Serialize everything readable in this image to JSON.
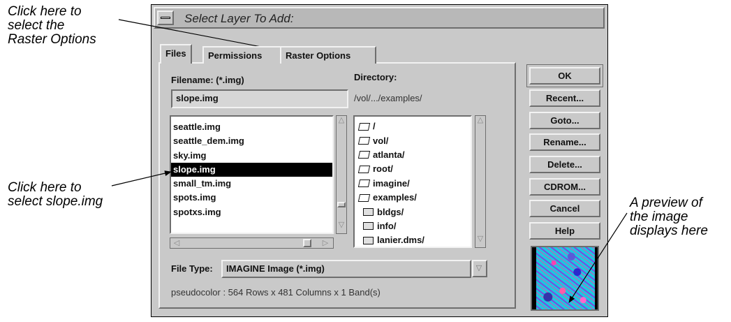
{
  "annotations": {
    "tabs_callout": [
      "Click here to",
      "select the",
      "Raster Options"
    ],
    "file_callout": [
      "Click here to",
      "select slope.img"
    ],
    "preview_callout": [
      "A preview of",
      "the image",
      "displays here"
    ]
  },
  "dialog": {
    "title": "Select Layer To Add:",
    "tabs": [
      "Files",
      "Permissions",
      "Raster Options"
    ],
    "filename_label": "Filename: (*.img)",
    "filename_value": "slope.img",
    "directory_label": "Directory:",
    "directory_value": "/vol/.../examples/",
    "files": [
      "seattle.img",
      "seattle_dem.img",
      "sky.img",
      "slope.img",
      "small_tm.img",
      "spots.img",
      "spotxs.img"
    ],
    "selected_file": "slope.img",
    "directories": [
      {
        "name": "/",
        "icon": "folder-open-icon"
      },
      {
        "name": "vol/",
        "icon": "folder-open-icon"
      },
      {
        "name": "atlanta/",
        "icon": "folder-open-icon"
      },
      {
        "name": "root/",
        "icon": "folder-open-icon"
      },
      {
        "name": "imagine/",
        "icon": "folder-open-icon"
      },
      {
        "name": "examples/",
        "icon": "folder-open-icon"
      },
      {
        "name": "bldgs/",
        "icon": "folder-closed-icon"
      },
      {
        "name": "info/",
        "icon": "folder-closed-icon"
      },
      {
        "name": "lanier.dms/",
        "icon": "folder-closed-icon"
      }
    ],
    "file_type_label": "File Type:",
    "file_type_value": "IMAGINE Image (*.img)",
    "status": "pseudocolor : 564 Rows x 481 Columns x 1 Band(s)",
    "buttons": [
      "OK",
      "Recent...",
      "Goto...",
      "Rename...",
      "Delete...",
      "CDROM...",
      "Cancel",
      "Help"
    ]
  }
}
